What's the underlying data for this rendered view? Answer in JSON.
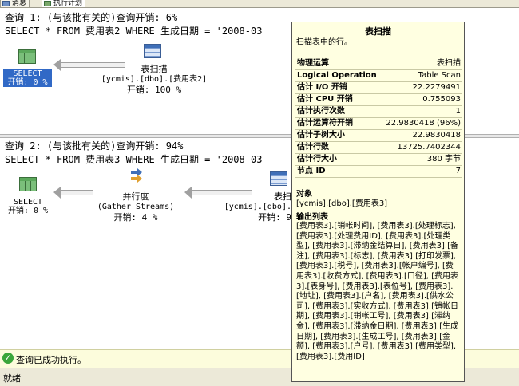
{
  "tabs": [
    {
      "label": "消息"
    },
    {
      "label": "执行计划"
    }
  ],
  "query1": {
    "header": "查询 1: (与该批有关的)查询开销: 6%",
    "sql": "SELECT * FROM 费用表2 WHERE 生成日期 = '2008-03",
    "select_node": {
      "name": "SELECT",
      "cost": "开销: 0 %"
    },
    "scan_node": {
      "name": "表扫描",
      "object": "[ycmis].[dbo].[费用表2]",
      "cost": "开销: 100 %"
    }
  },
  "query2": {
    "header": "查询 2: (与该批有关的)查询开销: 94%",
    "sql": "SELECT * FROM 费用表3 WHERE 生成日期 = '2008-03",
    "select_node": {
      "name": "SELECT",
      "cost": "开销: 0 %"
    },
    "parallel_node": {
      "name": "并行度",
      "sub": "(Gather Streams)",
      "cost": "开销: 4 %"
    },
    "scan_node": {
      "name": "表扫",
      "object": "[ycmis].[dbo].",
      "cost": "开销: 9"
    }
  },
  "tooltip": {
    "title": "表扫描",
    "description": "扫描表中的行。",
    "rows": [
      {
        "key": "物理运算",
        "value": "表扫描"
      },
      {
        "key": "Logical Operation",
        "value": "Table Scan"
      },
      {
        "key": "估计 I/O 开销",
        "value": "22.2279491"
      },
      {
        "key": "估计 CPU 开销",
        "value": "0.755093"
      },
      {
        "key": "估计执行次数",
        "value": "1"
      },
      {
        "key": "估计运算符开销",
        "value": "22.9830418 (96%)"
      },
      {
        "key": "估计子树大小",
        "value": "22.9830418"
      },
      {
        "key": "估计行数",
        "value": "13725.7402344"
      },
      {
        "key": "估计行大小",
        "value": "380 字节"
      },
      {
        "key": "节点 ID",
        "value": "7"
      }
    ],
    "object_label": "对象",
    "object_value": "[ycmis].[dbo].[费用表3]",
    "output_label": "输出列表",
    "output_columns": "[费用表3].[销帐时间], [费用表3].[处理标志], [费用表3].[处理费用ID], [费用表3].[处理类型], [费用表3].[滞纳金结算日], [费用表3].[备注], [费用表3].[标志], [费用表3].[打印发票], [费用表3].[税号], [费用表3].[帐户编号], [费用表3].[收费方式], [费用表3].[口径], [费用表3].[表身号], [费用表3].[表位号], [费用表3].[地址], [费用表3].[户名], [费用表3].[供水公司], [费用表3].[实收方式], [费用表3].[销帐日期], [费用表3].[销帐工号], [费用表3].[滞纳金], [费用表3].[滞纳金日期], [费用表3].[生成日期], [费用表3].[生成工号], [费用表3].[金额], [费用表3].[户号], [费用表3].[费用类型], [费用表3].[费用ID]"
  },
  "status": {
    "message": "查询已成功执行。"
  },
  "statusbar": {
    "text": "就绪"
  },
  "colors": {
    "selection": "#3169c6",
    "tooltip_bg": "#ffffe1",
    "status_bg": "#fcfcdc",
    "success": "#3aa63a"
  }
}
